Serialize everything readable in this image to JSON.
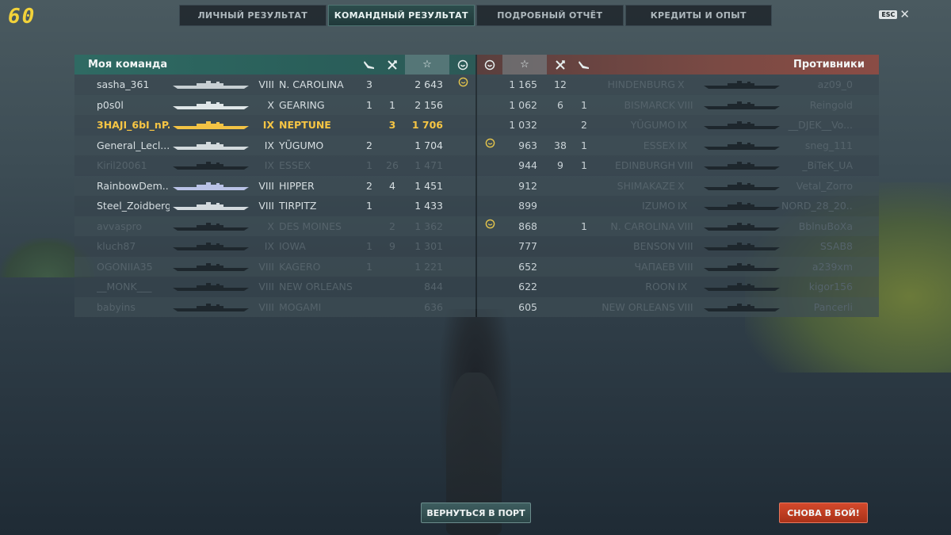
{
  "fps": "60",
  "tabs": [
    {
      "label": "ЛИЧНЫЙ РЕЗУЛЬТАТ",
      "active": false
    },
    {
      "label": "КОМАНДНЫЙ РЕЗУЛЬТАТ",
      "active": true
    },
    {
      "label": "ПОДРОБНЫЙ ОТЧЁТ",
      "active": false
    },
    {
      "label": "КРЕДИТЫ И ОПЫТ",
      "active": false
    }
  ],
  "esc": {
    "key": "ESC",
    "close": "✕"
  },
  "my_team": {
    "title": "Моя команда",
    "icons": {
      "planes": "plane-icon",
      "kills": "crossed-swords-icon",
      "score": "☆",
      "medal": "medal-icon"
    },
    "rows": [
      {
        "player": "sasha_361",
        "tier": "VIII",
        "ship": "N. CAROLINA",
        "planes": "3",
        "kills": "",
        "score": "2 643",
        "medal": true,
        "state": "alive",
        "hull": "#c7cfd3"
      },
      {
        "player": "p0s0l",
        "tier": "X",
        "ship": "GEARING",
        "planes": "1",
        "kills": "1",
        "score": "2 156",
        "medal": false,
        "state": "alive",
        "hull": "#dfe6e8"
      },
      {
        "player": "3HAJI_6bI_nP...",
        "tier": "IX",
        "ship": "NEPTUNE",
        "planes": "",
        "kills": "3",
        "score": "1 706",
        "medal": false,
        "state": "me",
        "hull": "#f3c344"
      },
      {
        "player": "General_Lecl...",
        "tier": "IX",
        "ship": "YŪGUMO",
        "planes": "2",
        "kills": "",
        "score": "1 704",
        "medal": false,
        "state": "alive",
        "hull": "#d3dadd"
      },
      {
        "player": "Kiril20061",
        "tier": "IX",
        "ship": "ESSEX",
        "planes": "1",
        "kills": "26",
        "score": "1 471",
        "medal": false,
        "state": "dead",
        "hull": "#1e272d"
      },
      {
        "player": "RainbowDem...",
        "tier": "VIII",
        "ship": "HIPPER",
        "planes": "2",
        "kills": "4",
        "score": "1 451",
        "medal": false,
        "state": "alive",
        "hull": "#b9c2e6"
      },
      {
        "player": "Steel_Zoidberg",
        "tier": "VIII",
        "ship": "TIRPITZ",
        "planes": "1",
        "kills": "",
        "score": "1 433",
        "medal": false,
        "state": "alive",
        "hull": "#d3dadd"
      },
      {
        "player": "avvaspro",
        "tier": "X",
        "ship": "DES MOINES",
        "planes": "",
        "kills": "2",
        "score": "1 362",
        "medal": false,
        "state": "dead",
        "hull": "#1e272d"
      },
      {
        "player": "kluch87",
        "tier": "IX",
        "ship": "IOWA",
        "planes": "1",
        "kills": "9",
        "score": "1 301",
        "medal": false,
        "state": "dead",
        "hull": "#1e272d"
      },
      {
        "player": "OGONIIA35",
        "tier": "VIII",
        "ship": "KAGERO",
        "planes": "1",
        "kills": "",
        "score": "1 221",
        "medal": false,
        "state": "dead",
        "hull": "#1e272d"
      },
      {
        "player": "__MONK___",
        "tier": "VIII",
        "ship": "NEW ORLEANS",
        "planes": "",
        "kills": "",
        "score": "844",
        "medal": false,
        "state": "dead",
        "hull": "#1e272d"
      },
      {
        "player": "babyins",
        "tier": "VIII",
        "ship": "MOGAMI",
        "planes": "",
        "kills": "",
        "score": "636",
        "medal": false,
        "state": "dead",
        "hull": "#1e272d"
      }
    ]
  },
  "enemies": {
    "title": "Противники",
    "icons": {
      "medal": "medal-icon",
      "score": "☆",
      "kills": "crossed-swords-icon",
      "planes": "plane-icon"
    },
    "rows": [
      {
        "medal": false,
        "score": "1 165",
        "kills": "12",
        "planes": "",
        "ship": "HINDENBURG",
        "tier": "X",
        "player": "az09_0"
      },
      {
        "medal": false,
        "score": "1 062",
        "kills": "6",
        "planes": "1",
        "ship": "BISMARCK",
        "tier": "VIII",
        "player": "Reingold"
      },
      {
        "medal": false,
        "score": "1 032",
        "kills": "",
        "planes": "2",
        "ship": "YŪGUMO",
        "tier": "IX",
        "player": "__DJEK__Vo..."
      },
      {
        "medal": true,
        "score": "963",
        "kills": "38",
        "planes": "1",
        "ship": "ESSEX",
        "tier": "IX",
        "player": "sneg_111"
      },
      {
        "medal": false,
        "score": "944",
        "kills": "9",
        "planes": "1",
        "ship": "EDINBURGH",
        "tier": "VIII",
        "player": "_BiTeK_UA"
      },
      {
        "medal": false,
        "score": "912",
        "kills": "",
        "planes": "",
        "ship": "SHIMAKAZE",
        "tier": "X",
        "player": "Vetal_Zorro"
      },
      {
        "medal": false,
        "score": "899",
        "kills": "",
        "planes": "",
        "ship": "IZUMO",
        "tier": "IX",
        "player": "NORD_28_20..."
      },
      {
        "medal": true,
        "score": "868",
        "kills": "",
        "planes": "1",
        "ship": "N. CAROLINA",
        "tier": "VIII",
        "player": "BblnuBoXa"
      },
      {
        "medal": false,
        "score": "777",
        "kills": "",
        "planes": "",
        "ship": "BENSON",
        "tier": "VIII",
        "player": "SSAB8"
      },
      {
        "medal": false,
        "score": "652",
        "kills": "",
        "planes": "",
        "ship": "ЧАПАЕВ",
        "tier": "VIII",
        "player": "a239xm"
      },
      {
        "medal": false,
        "score": "622",
        "kills": "",
        "planes": "",
        "ship": "ROON",
        "tier": "IX",
        "player": "kigor156"
      },
      {
        "medal": false,
        "score": "605",
        "kills": "",
        "planes": "",
        "ship": "NEW ORLEANS",
        "tier": "VIII",
        "player": "Pancerli"
      }
    ]
  },
  "buttons": {
    "port": "ВЕРНУТЬСЯ В ПОРТ",
    "battle": "СНОВА В БОЙ!"
  },
  "colors": {
    "player_highlight": "#f6c544",
    "battle_button": "#c23d22",
    "my_team_header": "#2f6a63",
    "enemy_header": "#7a4a44"
  }
}
